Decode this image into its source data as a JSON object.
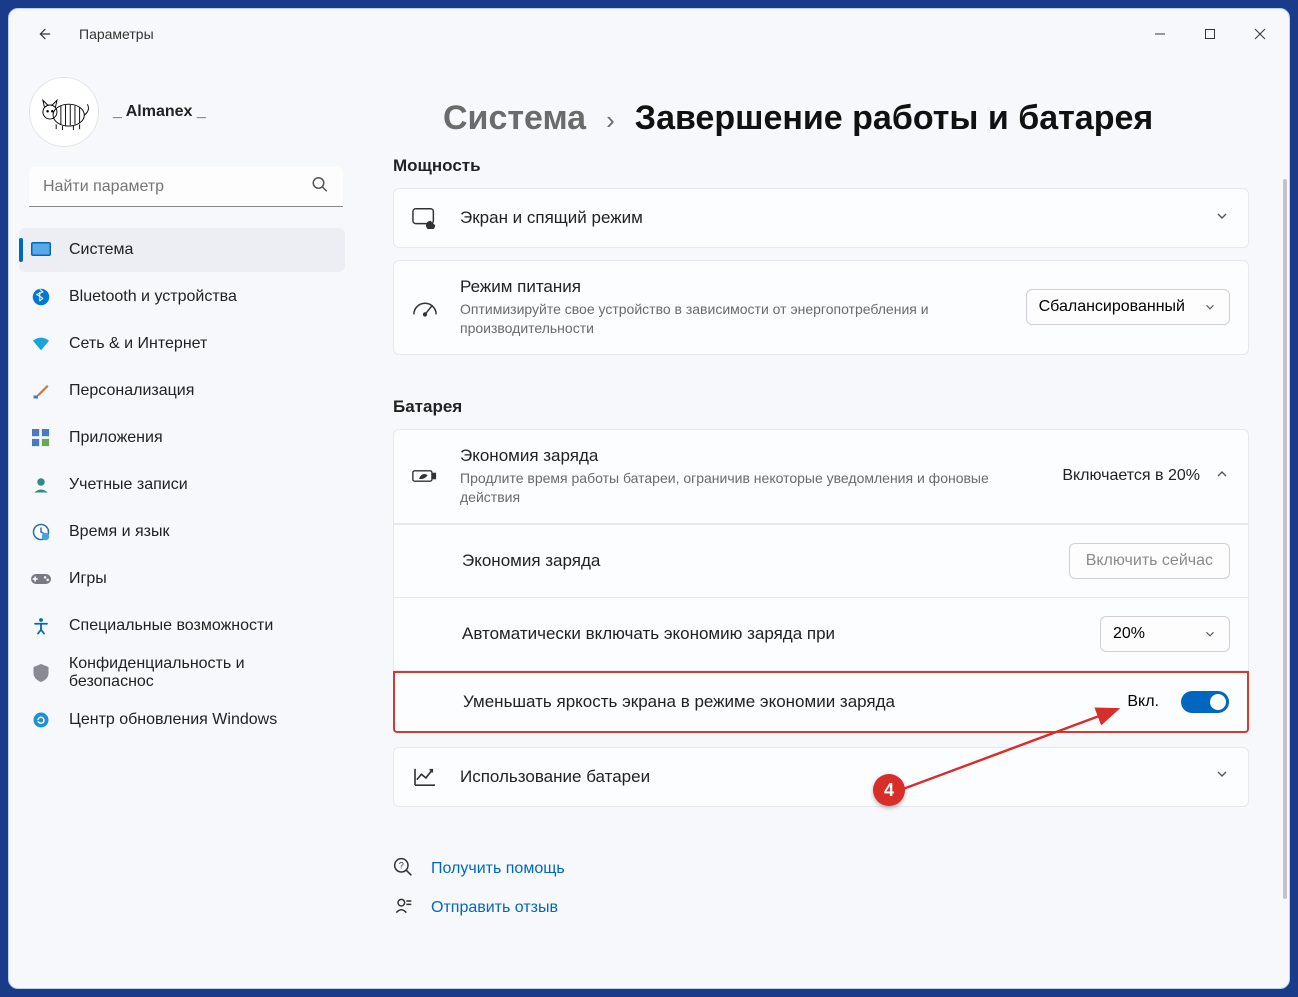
{
  "titlebar": {
    "app_name": "Параметры"
  },
  "profile": {
    "username": "_ Almanex _"
  },
  "search": {
    "placeholder": "Найти параметр"
  },
  "sidebar": {
    "items": [
      {
        "label": "Система"
      },
      {
        "label": "Bluetooth и устройства"
      },
      {
        "label": "Сеть & и Интернет"
      },
      {
        "label": "Персонализация"
      },
      {
        "label": "Приложения"
      },
      {
        "label": "Учетные записи"
      },
      {
        "label": "Время и язык"
      },
      {
        "label": "Игры"
      },
      {
        "label": "Специальные возможности"
      },
      {
        "label": "Конфиденциальность и безопаснос"
      },
      {
        "label": "Центр обновления Windows"
      }
    ]
  },
  "breadcrumb": {
    "parent": "Система",
    "sep": "›",
    "current": "Завершение работы и батарея"
  },
  "sections": {
    "power_hdr": "Мощность",
    "battery_hdr": "Батарея"
  },
  "cards": {
    "screen_sleep": {
      "title": "Экран и спящий режим"
    },
    "power_mode": {
      "title": "Режим питания",
      "sub": "Оптимизируйте свое устройство в зависимости от энергопотребления и производительности",
      "value": "Сбалансированный"
    },
    "battery_saver": {
      "title": "Экономия заряда",
      "sub": "Продлите время работы батареи, ограничив некоторые уведомления и фоновые действия",
      "value": "Включается в 20%"
    },
    "saver_now": {
      "title": "Экономия заряда",
      "button": "Включить сейчас"
    },
    "saver_auto": {
      "title": "Автоматически включать экономию заряда при",
      "value": "20%"
    },
    "dim": {
      "title": "Уменьшать яркость экрана в режиме экономии заряда",
      "state": "Вкл."
    },
    "usage": {
      "title": "Использование батареи"
    }
  },
  "links": {
    "help": "Получить помощь",
    "feedback": "Отправить отзыв"
  },
  "annotation": {
    "badge": "4"
  }
}
